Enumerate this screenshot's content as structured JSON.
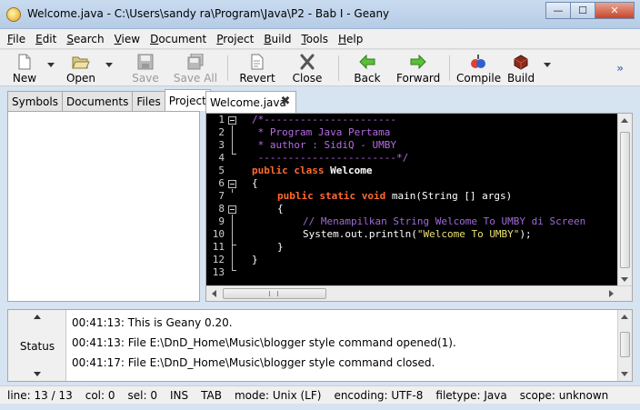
{
  "window": {
    "title": "Welcome.java - C:\\Users\\sandy ra\\Program\\Java\\P2 - Bab I - Geany",
    "min_glyph": "—",
    "max_glyph": "☐",
    "close_glyph": "✕"
  },
  "menu": [
    "File",
    "Edit",
    "Search",
    "View",
    "Document",
    "Project",
    "Build",
    "Tools",
    "Help"
  ],
  "toolbar": {
    "new": "New",
    "open": "Open",
    "save": "Save",
    "save_all": "Save All",
    "revert": "Revert",
    "close": "Close",
    "back": "Back",
    "forward": "Forward",
    "compile": "Compile",
    "build": "Build",
    "more": "»"
  },
  "sidebar": {
    "tabs": [
      "Symbols",
      "Documents",
      "Files",
      "Project"
    ],
    "active_tab": "Project"
  },
  "editor": {
    "tab_label": "Welcome.java",
    "close_glyph": "✖",
    "line_numbers": [
      "1",
      "2",
      "3",
      "4",
      "5",
      "6",
      "7",
      "8",
      "9",
      "10",
      "11",
      "12",
      "13"
    ],
    "lines": {
      "l1": "/*----------------------",
      "l2": " * Program Java Pertama",
      "l3": " * author : SidiQ - UMBY",
      "l4": " -----------------------*/",
      "l5_kw": "public class ",
      "l5_cls": "Welcome",
      "l6": "{",
      "l7_kw": "public static void ",
      "l7_rest": "main(String [] args)",
      "l8": "{",
      "l9": "// Menampilkan String Welcome To UMBY di Screen",
      "l10_a": "System.out.println(",
      "l10_str": "\"Welcome To UMBY\"",
      "l10_b": ");",
      "l11": "}",
      "l12": "}"
    },
    "colors": {
      "background": "#000000",
      "comment": "#b46be0",
      "keyword": "#ff6b2c",
      "string": "#e8e070"
    }
  },
  "messages": {
    "side_label": "Status",
    "lines": [
      "00:41:13: This is Geany 0.20.",
      "00:41:13: File E:\\DnD_Home\\Music\\blogger style command opened(1).",
      "00:41:17: File E:\\DnD_Home\\Music\\blogger style command closed."
    ]
  },
  "status": {
    "line": "line: 13 / 13",
    "col": "col: 0",
    "sel": "sel: 0",
    "ins": "INS",
    "tab": "TAB",
    "mode": "mode: Unix (LF)",
    "encoding": "encoding: UTF-8",
    "filetype": "filetype: Java",
    "scope": "scope: unknown"
  }
}
